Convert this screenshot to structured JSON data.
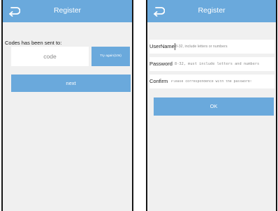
{
  "colors": {
    "accent": "#6aa9dc",
    "background": "#f0f0f0",
    "frame": "#141414"
  },
  "left_screen": {
    "header": {
      "title": "Register",
      "back_icon": "back-arrow-icon"
    },
    "sent_label": "Codes has been sent to:",
    "code_input": {
      "placeholder": "code",
      "value": ""
    },
    "retry_button": "Try again(10s)",
    "next_button": "next"
  },
  "right_screen": {
    "header": {
      "title": "Register",
      "back_icon": "back-arrow-icon"
    },
    "username": {
      "label": "UserName",
      "placeholder": "8-32, include letters or numbers",
      "value": ""
    },
    "password": {
      "label": "Password",
      "placeholder": "8-32, must include letters and numbers",
      "value": ""
    },
    "confirm": {
      "label": "Confirm",
      "placeholder": "Please correspondence with the password!",
      "value": ""
    },
    "ok_button": "OK"
  }
}
